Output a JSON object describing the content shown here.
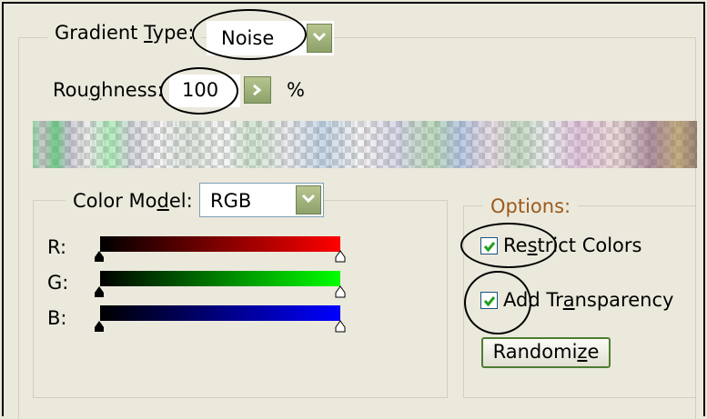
{
  "gradient_type": {
    "label_before": "Gradient ",
    "label_mnemonic": "T",
    "label_after": "ype:",
    "value": "Noise"
  },
  "roughness": {
    "label_before": "Rou",
    "label_mnemonic": "g",
    "label_after": "hness:",
    "value": "100",
    "unit": "%"
  },
  "color_model": {
    "label_before": "Color Mo",
    "label_mnemonic": "d",
    "label_after": "el:",
    "value": "RGB",
    "channels": [
      {
        "label": "R:",
        "color": "#ff0000",
        "min": 0,
        "max": 100
      },
      {
        "label": "G:",
        "color": "#00ff00",
        "min": 0,
        "max": 100
      },
      {
        "label": "B:",
        "color": "#0000ff",
        "min": 0,
        "max": 100
      }
    ]
  },
  "options": {
    "title": "Options:",
    "title_color": "#9c5a1c",
    "restrict_colors": {
      "label_before": "Re",
      "label_mnemonic": "s",
      "label_after": "trict Colors",
      "checked": true
    },
    "add_transparency": {
      "label_before": "Add Tr",
      "label_mnemonic": "a",
      "label_after": "nsparency",
      "checked": true
    },
    "randomize": {
      "label_before": "Randomi",
      "label_mnemonic": "z",
      "label_after": "e"
    }
  },
  "accent_colors": {
    "dropdown_arrow": "#8ea16a",
    "focus_border": "#4e7d32",
    "checkmark": "#21a121"
  }
}
